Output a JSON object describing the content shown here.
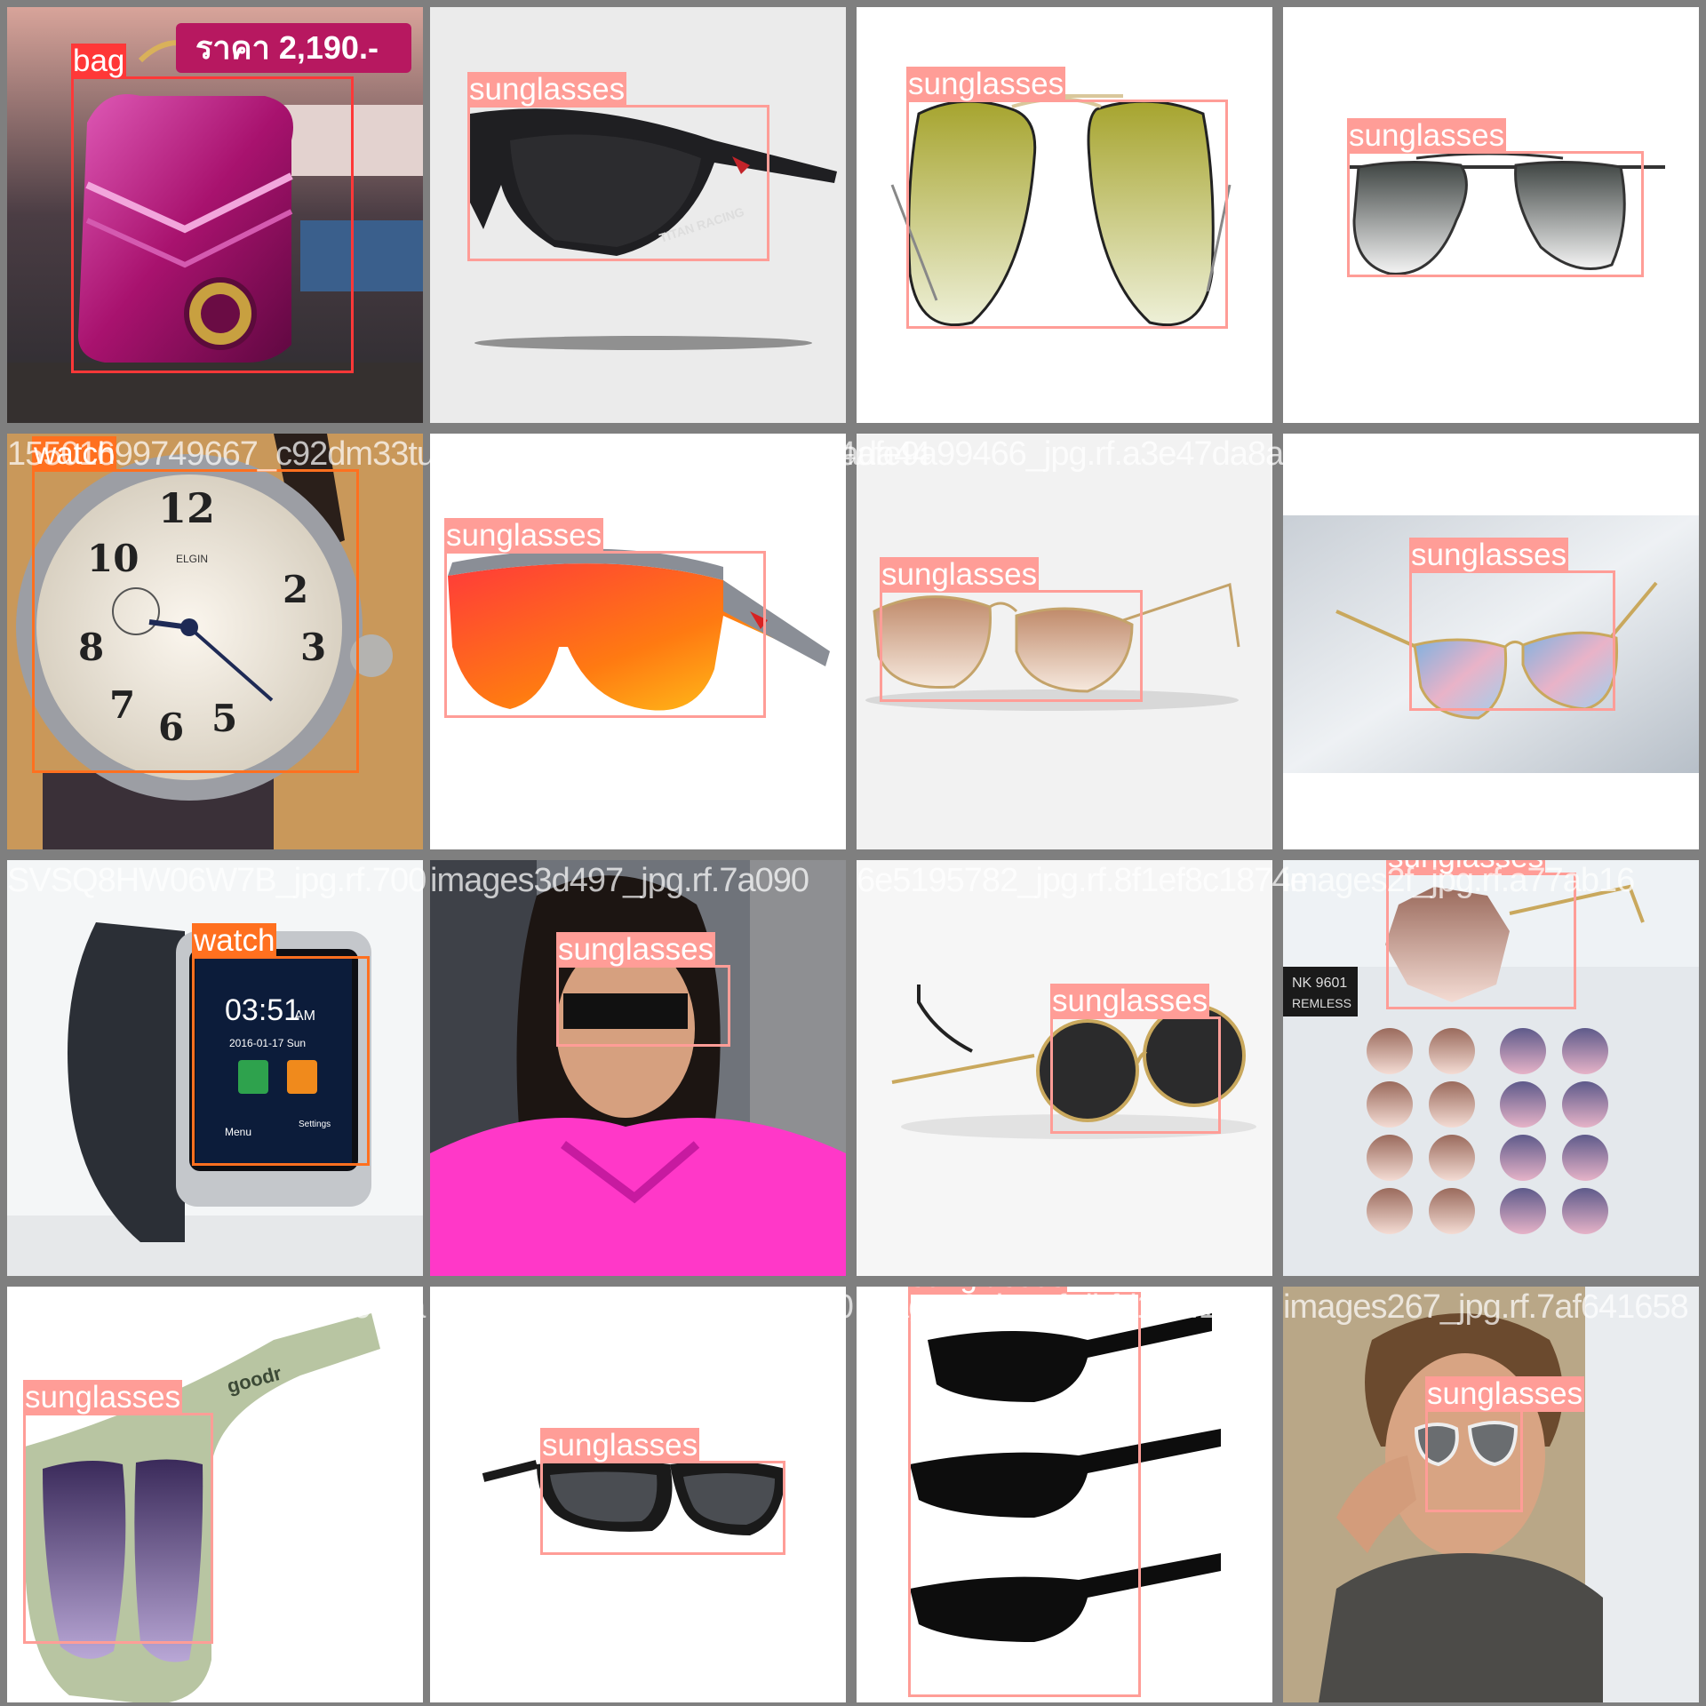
{
  "colors": {
    "bag": "#ff3838",
    "watch": "#ff701f",
    "sunglasses": "#ff9d97",
    "tile_border": "#7f7f7f"
  },
  "tiles": [
    {
      "filename": "",
      "price_tag": "ราคา 2,190.-",
      "detections": [
        {
          "label": "bag"
        }
      ]
    },
    {
      "filename": "",
      "product_text": "TITAN RACING",
      "detections": [
        {
          "label": "sunglasses"
        }
      ]
    },
    {
      "filename": "",
      "detections": [
        {
          "label": "sunglasses"
        }
      ]
    },
    {
      "filename": "",
      "detections": [
        {
          "label": "sunglasses"
        }
      ]
    },
    {
      "filename": "15501699749667_c92dm33tuk_jpg.rf.1489617f511ff6ada44",
      "dial_text": "ELGIN",
      "detections": [
        {
          "label": "watch"
        }
      ]
    },
    {
      "filename": "images148961_jpg.rf.5511ff6ada44",
      "detections": [
        {
          "label": "sunglasses"
        }
      ]
    },
    {
      "filename": "afe9a99466_jpg.rf.a3e47da8a7",
      "detections": [
        {
          "label": "sunglasses"
        }
      ]
    },
    {
      "filename": "images2005_jpg.rf.190de1c6",
      "detections": [
        {
          "label": "sunglasses"
        }
      ]
    },
    {
      "filename": "SVSQ8HW06W7B_jpg.rf.700",
      "screen_time": "03:51",
      "screen_ampm": "AM",
      "screen_date": "2016-01-17 Sun",
      "screen_menu": "Menu",
      "screen_settings": "Settings",
      "detections": [
        {
          "label": "watch"
        }
      ]
    },
    {
      "filename": "images3d497_jpg.rf.7a090",
      "detections": [
        {
          "label": "sunglasses"
        }
      ]
    },
    {
      "filename": "6e5195782_jpg.rf.8f1ef8c1874e",
      "detections": [
        {
          "label": "sunglasses"
        }
      ]
    },
    {
      "filename": "images2f_jpg.rf.a77ab16",
      "sign_text": [
        "NK 9601",
        "REMLESS"
      ],
      "detections": [
        {
          "label": "sunglasses"
        }
      ]
    },
    {
      "filename": "VJY7MU6V5NXZ_jpg.rf.9e1a",
      "product_text": "goodr",
      "detections": [
        {
          "label": "sunglasses"
        }
      ]
    },
    {
      "filename": "images961_jpg.rf.18272d1fb0",
      "detections": [
        {
          "label": "sunglasses"
        }
      ]
    },
    {
      "filename": "images8_jpg.rf.dbfd182f1",
      "detections": [
        {
          "label": "sunglasses"
        }
      ]
    },
    {
      "filename": "images267_jpg.rf.7af641658",
      "detections": [
        {
          "label": "sunglasses"
        }
      ]
    }
  ]
}
